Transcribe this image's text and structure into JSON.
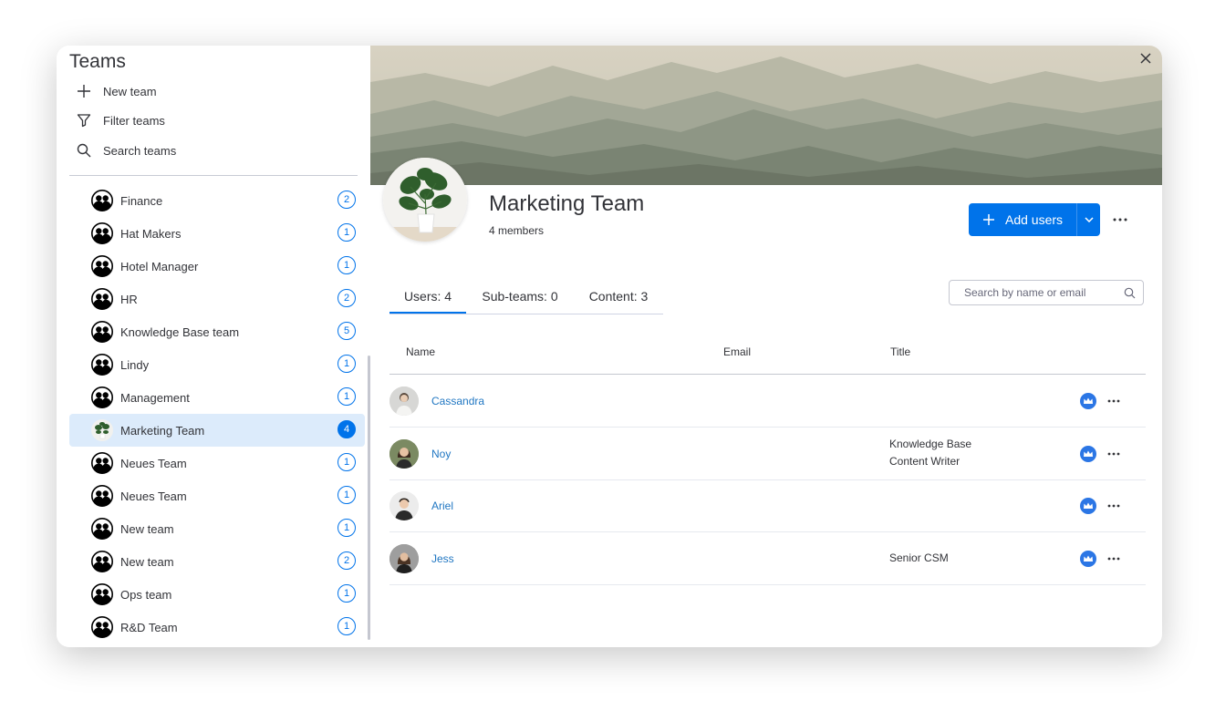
{
  "sidebar": {
    "title": "Teams",
    "actions": [
      {
        "label": "New team",
        "icon": "plus-icon"
      },
      {
        "label": "Filter teams",
        "icon": "filter-icon"
      },
      {
        "label": "Search teams",
        "icon": "search-icon"
      }
    ],
    "teams": [
      {
        "name": "Finance",
        "count": "2",
        "selected": false
      },
      {
        "name": "Hat Makers",
        "count": "1",
        "selected": false
      },
      {
        "name": "Hotel Manager",
        "count": "1",
        "selected": false
      },
      {
        "name": "HR",
        "count": "2",
        "selected": false
      },
      {
        "name": "Knowledge Base team",
        "count": "5",
        "selected": false
      },
      {
        "name": "Lindy",
        "count": "1",
        "selected": false
      },
      {
        "name": "Management",
        "count": "1",
        "selected": false
      },
      {
        "name": "Marketing Team",
        "count": "4",
        "selected": true
      },
      {
        "name": "Neues Team",
        "count": "1",
        "selected": false
      },
      {
        "name": "Neues Team",
        "count": "1",
        "selected": false
      },
      {
        "name": "New team",
        "count": "1",
        "selected": false
      },
      {
        "name": "New team",
        "count": "2",
        "selected": false
      },
      {
        "name": "Ops team",
        "count": "1",
        "selected": false
      },
      {
        "name": "R&D Team",
        "count": "1",
        "selected": false
      }
    ]
  },
  "team": {
    "title": "Marketing Team",
    "members": "4 members",
    "add_users_label": "Add users"
  },
  "tabs": [
    {
      "label": "Users: 4",
      "active": true
    },
    {
      "label": "Sub-teams: 0",
      "active": false
    },
    {
      "label": "Content: 3",
      "active": false
    }
  ],
  "search": {
    "placeholder": "Search by name or email",
    "value": ""
  },
  "table": {
    "headers": {
      "name": "Name",
      "email": "Email",
      "title": "Title"
    },
    "rows": [
      {
        "name": "Cassandra",
        "email": "",
        "title_lines": [],
        "avatar_color": "#d9d9d9"
      },
      {
        "name": "Noy",
        "email": "",
        "title_lines": [
          "Knowledge Base",
          "Content Writer"
        ],
        "avatar_color": "#7a8a62"
      },
      {
        "name": "Ariel",
        "email": "",
        "title_lines": [],
        "avatar_color": "#e8e8e8"
      },
      {
        "name": "Jess",
        "email": "",
        "title_lines": [
          "Senior CSM"
        ],
        "avatar_color": "#9a9a9a"
      }
    ]
  },
  "colors": {
    "accent": "#0073ea",
    "link": "#1f76c2",
    "selected_bg": "#dcebfb",
    "crown": "#2b76e5"
  }
}
